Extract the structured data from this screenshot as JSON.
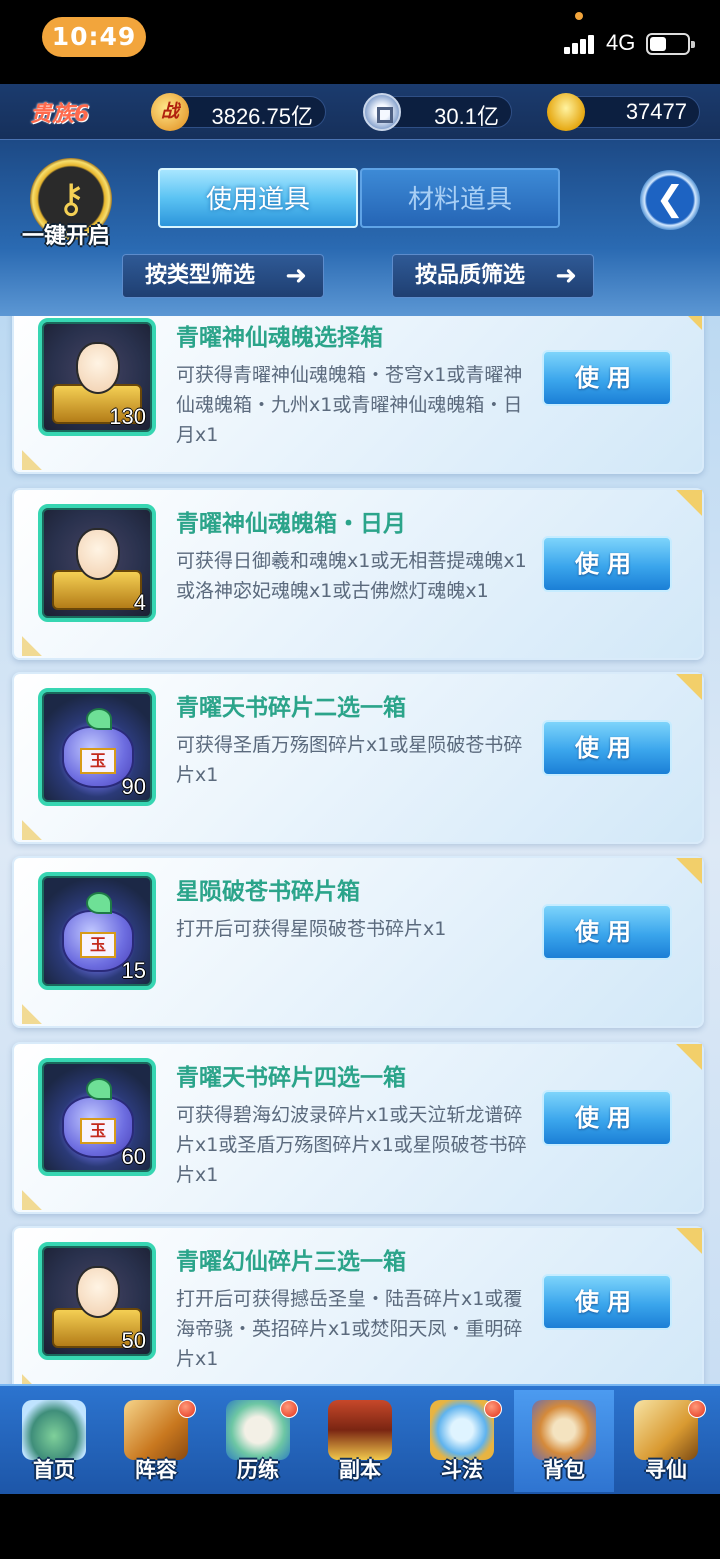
{
  "status_bar": {
    "time": "10:49",
    "network": "4G"
  },
  "resources": {
    "vip": "贵族6",
    "power_icon": "战",
    "power": "3826.75亿",
    "coins": "30.1亿",
    "gold": "37477"
  },
  "header": {
    "one_key_open": "一键开启",
    "tabs": [
      "使用道具",
      "材料道具"
    ],
    "filter_type": "按类型筛选",
    "filter_quality": "按品质筛选"
  },
  "items": [
    {
      "name": "青曜神仙魂魄选择箱",
      "desc": "可获得青曜神仙魂魄箱・苍穹x1或青曜神仙魂魄箱・九州x1或青曜神仙魂魄箱・日月x1",
      "count": "130",
      "kind": "portrait"
    },
    {
      "name": "青曜神仙魂魄箱・日月",
      "desc": "可获得日御羲和魂魄x1或无相菩提魂魄x1或洛神宓妃魂魄x1或古佛燃灯魂魄x1",
      "count": "4",
      "kind": "portrait"
    },
    {
      "name": "青曜天书碎片二选一箱",
      "desc": "可获得圣盾万殇图碎片x1或星陨破苍书碎片x1",
      "count": "90",
      "kind": "bag"
    },
    {
      "name": "星陨破苍书碎片箱",
      "desc": "打开后可获得星陨破苍书碎片x1",
      "count": "15",
      "kind": "bag"
    },
    {
      "name": "青曜天书碎片四选一箱",
      "desc": "可获得碧海幻波录碎片x1或天泣斩龙谱碎片x1或圣盾万殇图碎片x1或星陨破苍书碎片x1",
      "count": "60",
      "kind": "bag"
    },
    {
      "name": "青曜幻仙碎片三选一箱",
      "desc": "打开后可获得撼岳圣皇・陆吾碎片x1或覆海帝骁・英招碎片x1或焚阳天凤・重明碎片x1",
      "count": "50",
      "kind": "portrait"
    }
  ],
  "use_label": "使用",
  "bag_mark": "玉",
  "nav": [
    {
      "label": "首页",
      "dot": false,
      "active": false
    },
    {
      "label": "阵容",
      "dot": true,
      "active": false
    },
    {
      "label": "历练",
      "dot": true,
      "active": false
    },
    {
      "label": "副本",
      "dot": false,
      "active": false
    },
    {
      "label": "斗法",
      "dot": true,
      "active": false
    },
    {
      "label": "背包",
      "dot": false,
      "active": true
    },
    {
      "label": "寻仙",
      "dot": true,
      "active": false
    }
  ]
}
